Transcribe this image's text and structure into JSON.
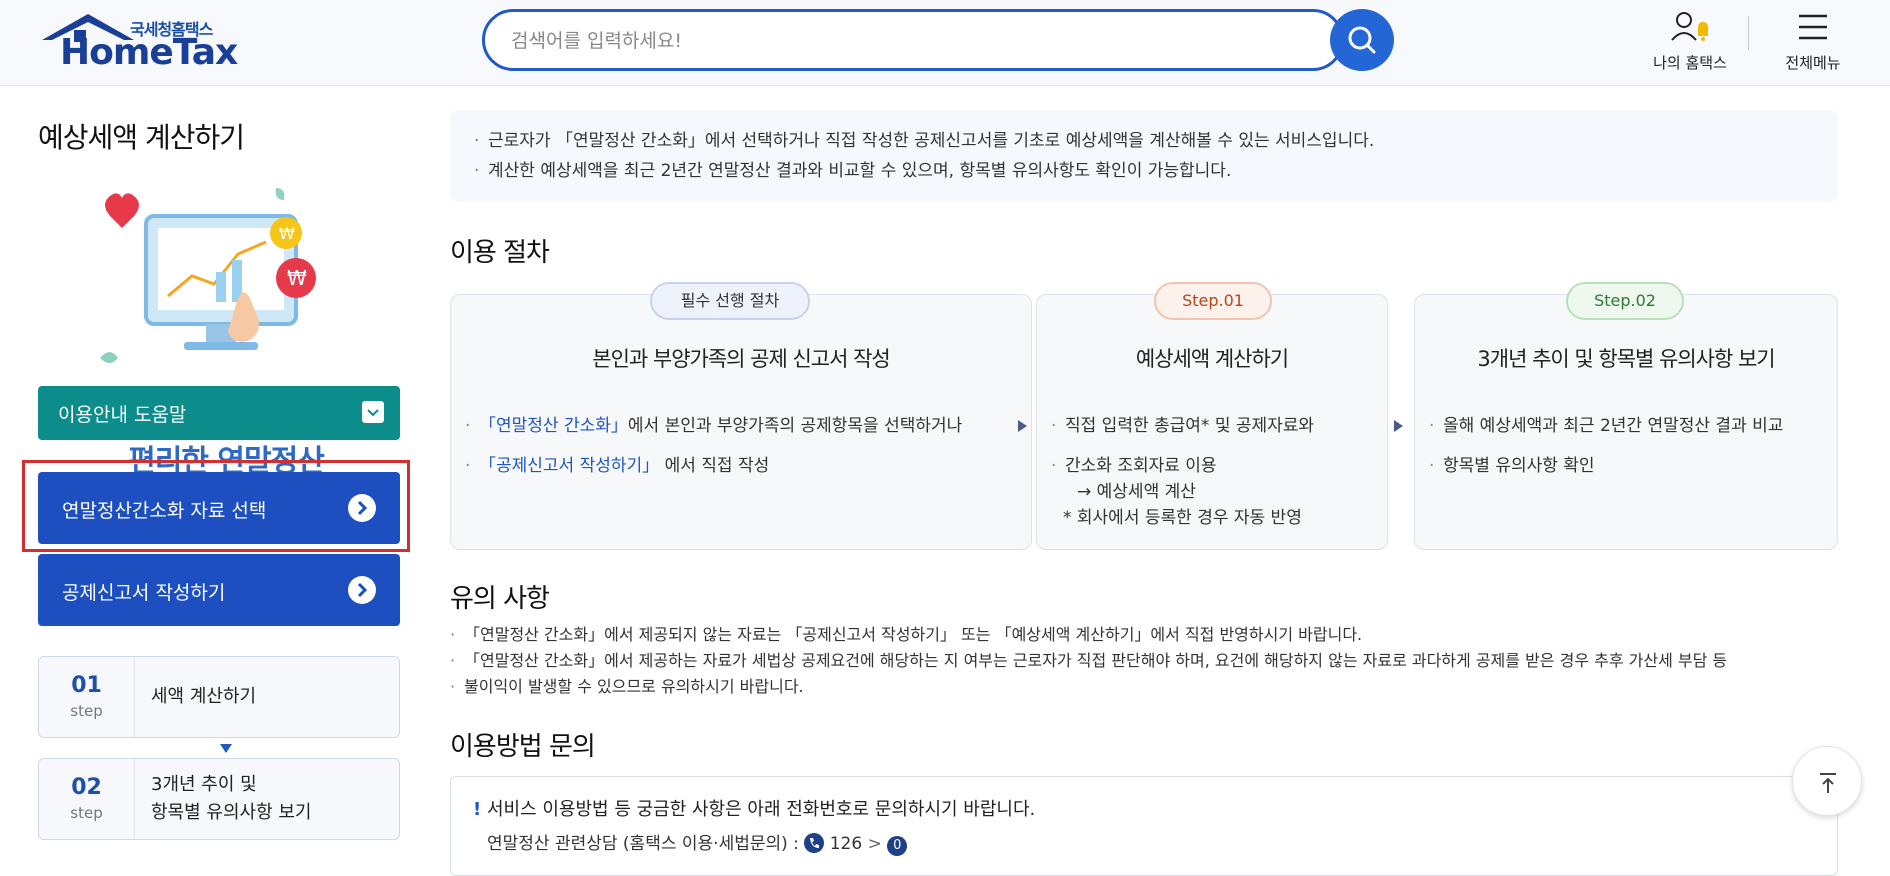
{
  "header": {
    "logo_sub": "국세청홈택스",
    "logo_main": "HomeTax",
    "search_placeholder": "검색어를 입력하세요!",
    "my_hometax": "나의 홈택스",
    "all_menu": "전체메뉴"
  },
  "sidebar": {
    "page_title": "예상세액 계산하기",
    "illustration_text": "편리한 연말정산",
    "guide_label": "이용안내 도움말",
    "btn_simplified": "연말정산간소화 자료 선택",
    "btn_declaration": "공제신고서 작성하기",
    "steps": [
      {
        "num": "01",
        "unit": "step",
        "label": "세액 계산하기"
      },
      {
        "num": "02",
        "unit": "step",
        "label_line1": "3개년 추이 및",
        "label_line2": "항목별 유의사항 보기"
      }
    ]
  },
  "intro": {
    "line1": "근로자가 「연말정산 간소화」에서 선택하거나 직접 작성한 공제신고서를 기초로 예상세액을 계산해볼 수 있는 서비스입니다.",
    "line2": "계산한 예상세액을 최근 2년간 연말정산 결과와 비교할 수 있으며, 항목별 유의사항도 확인이 가능합니다."
  },
  "procedure": {
    "title": "이용 절차",
    "cards": [
      {
        "pill": "필수 선행 절차",
        "head": "본인과 부양가족의 공제 신고서 작성",
        "item1_link": "「연말정산 간소화」",
        "item1_rest": "에서 본인과 부양가족의 공제항목을 선택하거나",
        "item2_link": "「공제신고서 작성하기」",
        "item2_rest": " 에서 직접 작성"
      },
      {
        "pill": "Step.01",
        "head": "예상세액 계산하기",
        "item1": "직접 입력한 총급여* 및 공제자료와",
        "item2": "간소화 조회자료 이용",
        "item2_sub": "→ 예상세액 계산",
        "item3": "* 회사에서 등록한 경우 자동 반영"
      },
      {
        "pill": "Step.02",
        "head": "3개년 추이 및 항목별 유의사항 보기",
        "item1": "올해 예상세액과 최근 2년간 연말정산 결과 비교",
        "item2": "항목별 유의사항 확인"
      }
    ]
  },
  "notes": {
    "title": "유의 사항",
    "line1": "「연말정산 간소화」에서 제공되지 않는 자료는 「공제신고서 작성하기」 또는 「예상세액 계산하기」에서 직접 반영하시기 바랍니다.",
    "line2": "「연말정산 간소화」에서 제공하는 자료가 세법상 공제요건에 해당하는 지 여부는 근로자가 직접 판단해야 하며, 요건에 해당하지 않는 자료로 과다하게 공제를 받은 경우 추후 가산세 부담 등",
    "line2_cont": "불이익이 발생할 수 있으므로 유의하시기 바랍니다."
  },
  "inquiry": {
    "title": "이용방법 문의",
    "line1": "서비스 이용방법 등 궁금한 사항은 아래 전화번호로 문의하시기 바랍니다.",
    "line2": "연말정산 관련상담 (홈택스 이용·세법문의) :",
    "phone": "126",
    "sep": ">",
    "option": "0"
  },
  "colors": {
    "brand_blue": "#1e4fc1",
    "teal": "#0d8c8c",
    "highlight_red": "#d32f2f"
  }
}
